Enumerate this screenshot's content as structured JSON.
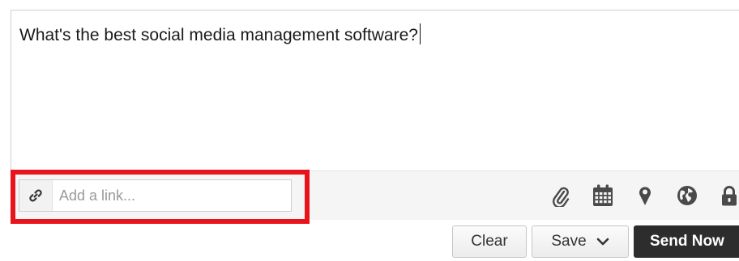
{
  "composer": {
    "message": "What's the best social media management software?"
  },
  "toolbar": {
    "link_placeholder": "Add a link...",
    "icons": [
      "paperclip-icon",
      "calendar-icon",
      "location-pin-icon",
      "globe-icon",
      "lock-icon"
    ]
  },
  "actions": {
    "clear_label": "Clear",
    "save_label": "Save",
    "send_label": "Send Now"
  },
  "colors": {
    "highlight": "#e8141b",
    "send_button": "#2d2d2d",
    "icon": "#4a4a4a"
  }
}
